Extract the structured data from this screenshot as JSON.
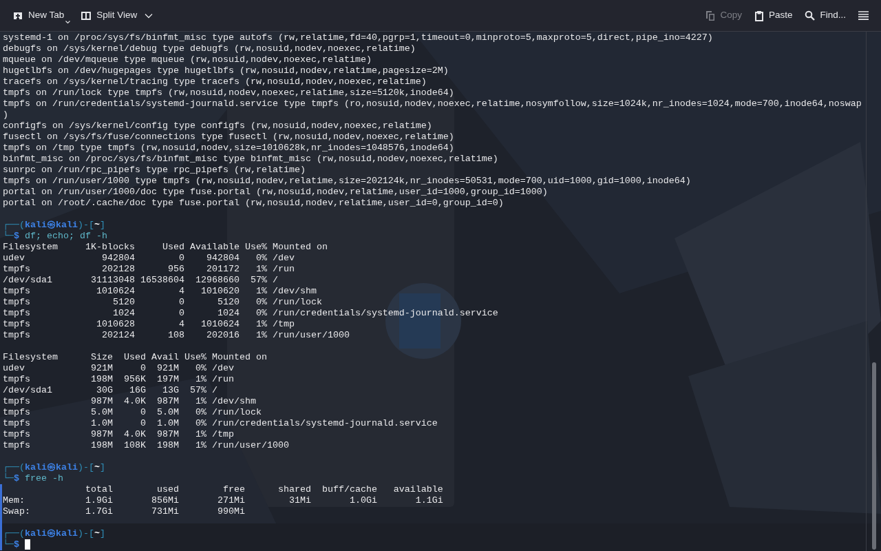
{
  "toolbar": {
    "left": [
      {
        "kind": "new_tab",
        "label": "New Tab",
        "disabled": false
      },
      {
        "kind": "split_view",
        "label": "Split View",
        "disabled": false
      }
    ],
    "right": [
      {
        "kind": "copy",
        "label": "Copy",
        "disabled": true
      },
      {
        "kind": "paste",
        "label": "Paste",
        "disabled": false
      },
      {
        "kind": "find",
        "label": "Find...",
        "disabled": false
      },
      {
        "kind": "menu",
        "disabled": false
      }
    ]
  },
  "terminal": {
    "lines": [
      {
        "kind": "text",
        "text": "systemd-1 on /proc/sys/fs/binfmt_misc type autofs (rw,relatime,fd=40,pgrp=1,timeout=0,minproto=5,maxproto=5,direct,pipe_ino=4227)"
      },
      {
        "kind": "text",
        "text": "debugfs on /sys/kernel/debug type debugfs (rw,nosuid,nodev,noexec,relatime)"
      },
      {
        "kind": "text",
        "text": "mqueue on /dev/mqueue type mqueue (rw,nosuid,nodev,noexec,relatime)"
      },
      {
        "kind": "text",
        "text": "hugetlbfs on /dev/hugepages type hugetlbfs (rw,nosuid,nodev,relatime,pagesize=2M)"
      },
      {
        "kind": "text",
        "text": "tracefs on /sys/kernel/tracing type tracefs (rw,nosuid,nodev,noexec,relatime)"
      },
      {
        "kind": "text",
        "text": "tmpfs on /run/lock type tmpfs (rw,nosuid,nodev,noexec,relatime,size=5120k,inode64)"
      },
      {
        "kind": "text",
        "text": "tmpfs on /run/credentials/systemd-journald.service type tmpfs (ro,nosuid,nodev,noexec,relatime,nosymfollow,size=1024k,nr_inodes=1024,mode=700,inode64,noswap"
      },
      {
        "kind": "text",
        "text": ")"
      },
      {
        "kind": "text",
        "text": "configfs on /sys/kernel/config type configfs (rw,nosuid,nodev,noexec,relatime)"
      },
      {
        "kind": "text",
        "text": "fusectl on /sys/fs/fuse/connections type fusectl (rw,nosuid,nodev,noexec,relatime)"
      },
      {
        "kind": "text",
        "text": "tmpfs on /tmp type tmpfs (rw,nosuid,nodev,size=1010628k,nr_inodes=1048576,inode64)"
      },
      {
        "kind": "text",
        "text": "binfmt_misc on /proc/sys/fs/binfmt_misc type binfmt_misc (rw,nosuid,nodev,noexec,relatime)"
      },
      {
        "kind": "text",
        "text": "sunrpc on /run/rpc_pipefs type rpc_pipefs (rw,relatime)"
      },
      {
        "kind": "text",
        "text": "tmpfs on /run/user/1000 type tmpfs (rw,nosuid,nodev,relatime,size=202124k,nr_inodes=50531,mode=700,uid=1000,gid=1000,inode64)"
      },
      {
        "kind": "text",
        "text": "portal on /run/user/1000/doc type fuse.portal (rw,nosuid,nodev,relatime,user_id=1000,group_id=1000)"
      },
      {
        "kind": "text",
        "text": "portal on /root/.cache/doc type fuse.portal (rw,nosuid,nodev,relatime,user_id=0,group_id=0)"
      },
      {
        "kind": "blank"
      },
      {
        "kind": "prompt",
        "open": "┌──(",
        "user": "kali",
        "symbol": "㉿",
        "host": "kali",
        "mid": ")-[",
        "dir": "~",
        "close": "]"
      },
      {
        "kind": "command",
        "lead": "└─",
        "sign": "$",
        "command": "df; echo; df -h"
      },
      {
        "kind": "text",
        "text": "Filesystem     1K-blocks     Used Available Use% Mounted on"
      },
      {
        "kind": "text",
        "text": "udev              942804        0    942804   0% /dev"
      },
      {
        "kind": "text",
        "text": "tmpfs             202128      956    201172   1% /run"
      },
      {
        "kind": "text",
        "text": "/dev/sda1       31113048 16538604  12968660  57% /"
      },
      {
        "kind": "text",
        "text": "tmpfs            1010624        4   1010620   1% /dev/shm"
      },
      {
        "kind": "text",
        "text": "tmpfs               5120        0      5120   0% /run/lock"
      },
      {
        "kind": "text",
        "text": "tmpfs               1024        0      1024   0% /run/credentials/systemd-journald.service"
      },
      {
        "kind": "text",
        "text": "tmpfs            1010628        4   1010624   1% /tmp"
      },
      {
        "kind": "text",
        "text": "tmpfs             202124      108    202016   1% /run/user/1000"
      },
      {
        "kind": "blank"
      },
      {
        "kind": "text",
        "text": "Filesystem      Size  Used Avail Use% Mounted on"
      },
      {
        "kind": "text",
        "text": "udev            921M     0  921M   0% /dev"
      },
      {
        "kind": "text",
        "text": "tmpfs           198M  956K  197M   1% /run"
      },
      {
        "kind": "text",
        "text": "/dev/sda1        30G   16G   13G  57% /"
      },
      {
        "kind": "text",
        "text": "tmpfs           987M  4.0K  987M   1% /dev/shm"
      },
      {
        "kind": "text",
        "text": "tmpfs           5.0M     0  5.0M   0% /run/lock"
      },
      {
        "kind": "text",
        "text": "tmpfs           1.0M     0  1.0M   0% /run/credentials/systemd-journald.service"
      },
      {
        "kind": "text",
        "text": "tmpfs           987M  4.0K  987M   1% /tmp"
      },
      {
        "kind": "text",
        "text": "tmpfs           198M  108K  198M   1% /run/user/1000"
      },
      {
        "kind": "blank"
      },
      {
        "kind": "prompt",
        "open": "┌──(",
        "user": "kali",
        "symbol": "㉿",
        "host": "kali",
        "mid": ")-[",
        "dir": "~",
        "close": "]"
      },
      {
        "kind": "command",
        "lead": "└─",
        "sign": "$",
        "command": "free -h"
      },
      {
        "kind": "text",
        "marked": true,
        "text": "               total        used        free      shared  buff/cache   available"
      },
      {
        "kind": "text",
        "marked": true,
        "text": "Mem:           1.9Gi       856Mi       271Mi        31Mi       1.0Gi       1.1Gi"
      },
      {
        "kind": "text",
        "marked": true,
        "text": "Swap:          1.7Gi       731Mi       990Mi"
      },
      {
        "kind": "blank",
        "marked": true
      },
      {
        "kind": "prompt",
        "marked": true,
        "open": "┌──(",
        "user": "kali",
        "symbol": "㉿",
        "host": "kali",
        "mid": ")-[",
        "dir": "~",
        "close": "]"
      },
      {
        "kind": "command",
        "marked": true,
        "lead": "└─",
        "sign": "$",
        "cursor": true
      }
    ]
  }
}
